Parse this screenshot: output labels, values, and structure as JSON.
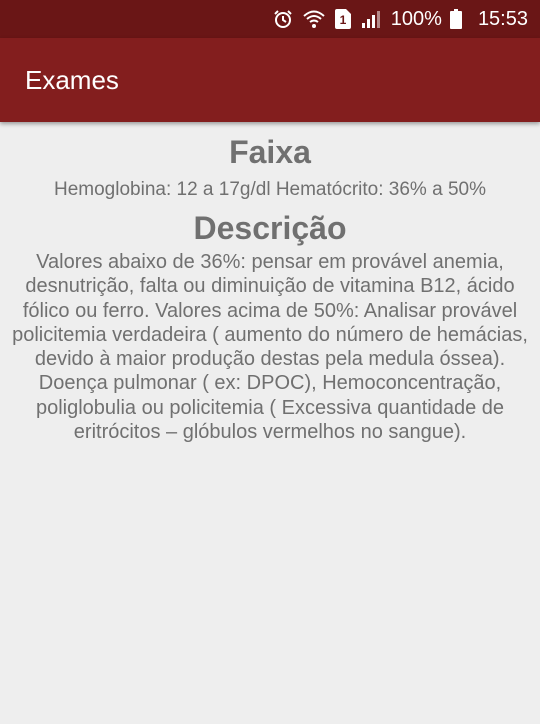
{
  "status_bar": {
    "battery_text": "100%",
    "time": "15:53",
    "sim_label": "1",
    "icons": [
      "alarm-icon",
      "wifi-icon",
      "sim-icon",
      "signal-icon",
      "battery-icon"
    ]
  },
  "app_bar": {
    "title": "Exames"
  },
  "content": {
    "range_heading": "Faixa",
    "range_text": "Hemoglobina: 12 a 17g/dl Hematócrito: 36% a 50%",
    "description_heading": "Descrição",
    "description_text": "Valores abaixo de 36%: pensar em provável anemia, desnutrição, falta ou diminuição de vitamina B12, ácido fólico ou ferro. Valores acima de 50%: Analisar provável policitemia verdadeira ( aumento do número de hemácias, devido à maior produção destas pela medula óssea). Doença pulmonar ( ex: DPOC), Hemoconcentração, poliglobulia ou policitemia ( Excessiva quantidade de eritrócitos – glóbulos vermelhos no sangue)."
  },
  "colors": {
    "status_bar": "#6a1616",
    "app_bar": "#831e1e",
    "background": "#eeeeee",
    "text": "#707070"
  }
}
